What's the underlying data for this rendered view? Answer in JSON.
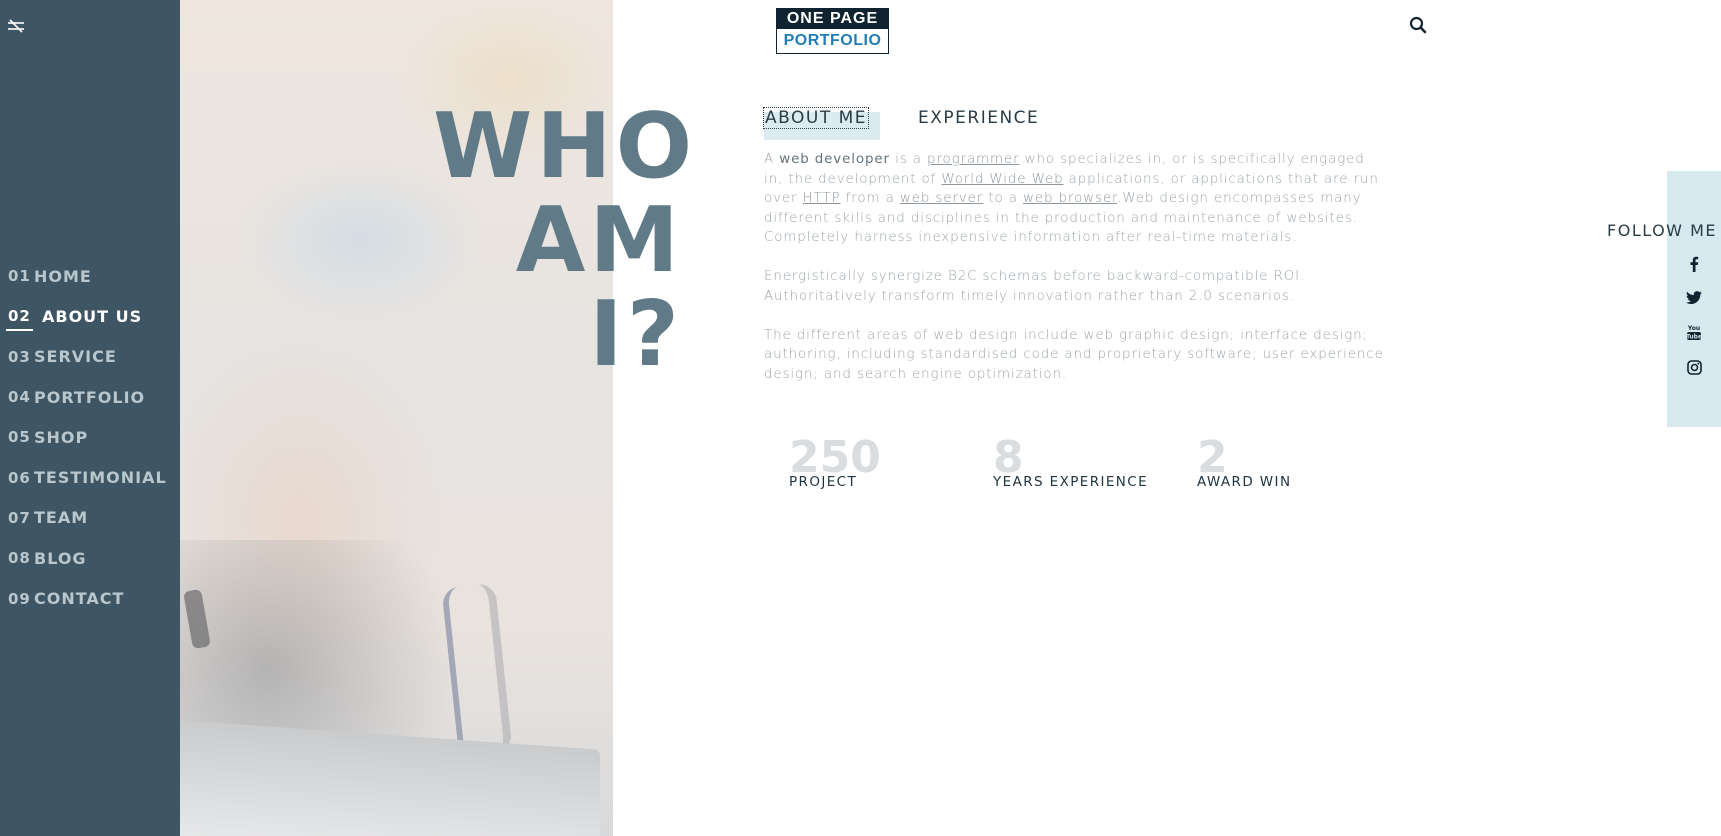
{
  "brand": {
    "line1": "ONE PAGE",
    "line2": "PORTFOLIO"
  },
  "nav": {
    "items": [
      {
        "num": "01",
        "label": "HOME"
      },
      {
        "num": "02",
        "label": "ABOUT US"
      },
      {
        "num": "03",
        "label": "SERVICE"
      },
      {
        "num": "04",
        "label": "PORTFOLIO"
      },
      {
        "num": "05",
        "label": "SHOP"
      },
      {
        "num": "06",
        "label": "TESTIMONIAL"
      },
      {
        "num": "07",
        "label": "TEAM"
      },
      {
        "num": "08",
        "label": "BLOG"
      },
      {
        "num": "09",
        "label": "CONTACT"
      }
    ],
    "active_index": 1
  },
  "hero": {
    "line1": "WHO",
    "line2": "AM I?"
  },
  "tabs": [
    {
      "label": "ABOUT ME"
    },
    {
      "label": "EXPERIENCE"
    }
  ],
  "about": {
    "p1": {
      "t1": "A ",
      "bold": "web developer",
      "t2": " is a ",
      "link1": "programmer",
      "t3": " who specializes in, or is specifically engaged in, the development of ",
      "link2": "World Wide Web",
      "t4": " applications, or applications that are run over ",
      "link3": "HTTP",
      "t5": " from a ",
      "link4": "web server",
      "t6": " to a ",
      "link5": "web browser",
      "t7": ".Web design encompasses many different skills and disciplines in the production and maintenance of websites. Completely harness inexpensive information after real-time materials."
    },
    "p2": "Energistically synergize B2C schemas before backward-compatible ROI. Authoritatively transform timely innovation rather than 2.0 scenarios.",
    "p3": "The different areas of web design include web graphic design; interface design; authoring, including standardised code and proprietary software; user experience design; and search engine optimization."
  },
  "stats": [
    {
      "value": "250",
      "label": "PROJECT"
    },
    {
      "value": "8",
      "label": "YEARS EXPERIENCE"
    },
    {
      "value": "2",
      "label": "AWARD WIN"
    }
  ],
  "follow": {
    "label": "FOLLOW ME",
    "icons": [
      "facebook-icon",
      "twitter-icon",
      "youtube-icon",
      "instagram-icon"
    ]
  },
  "colors": {
    "sidebar": "#3e5663",
    "hero_text": "#617a87",
    "accent_blue": "#1f7fb6",
    "follow_panel": "#d6e9ef",
    "tab_highlight": "#dcebef"
  }
}
